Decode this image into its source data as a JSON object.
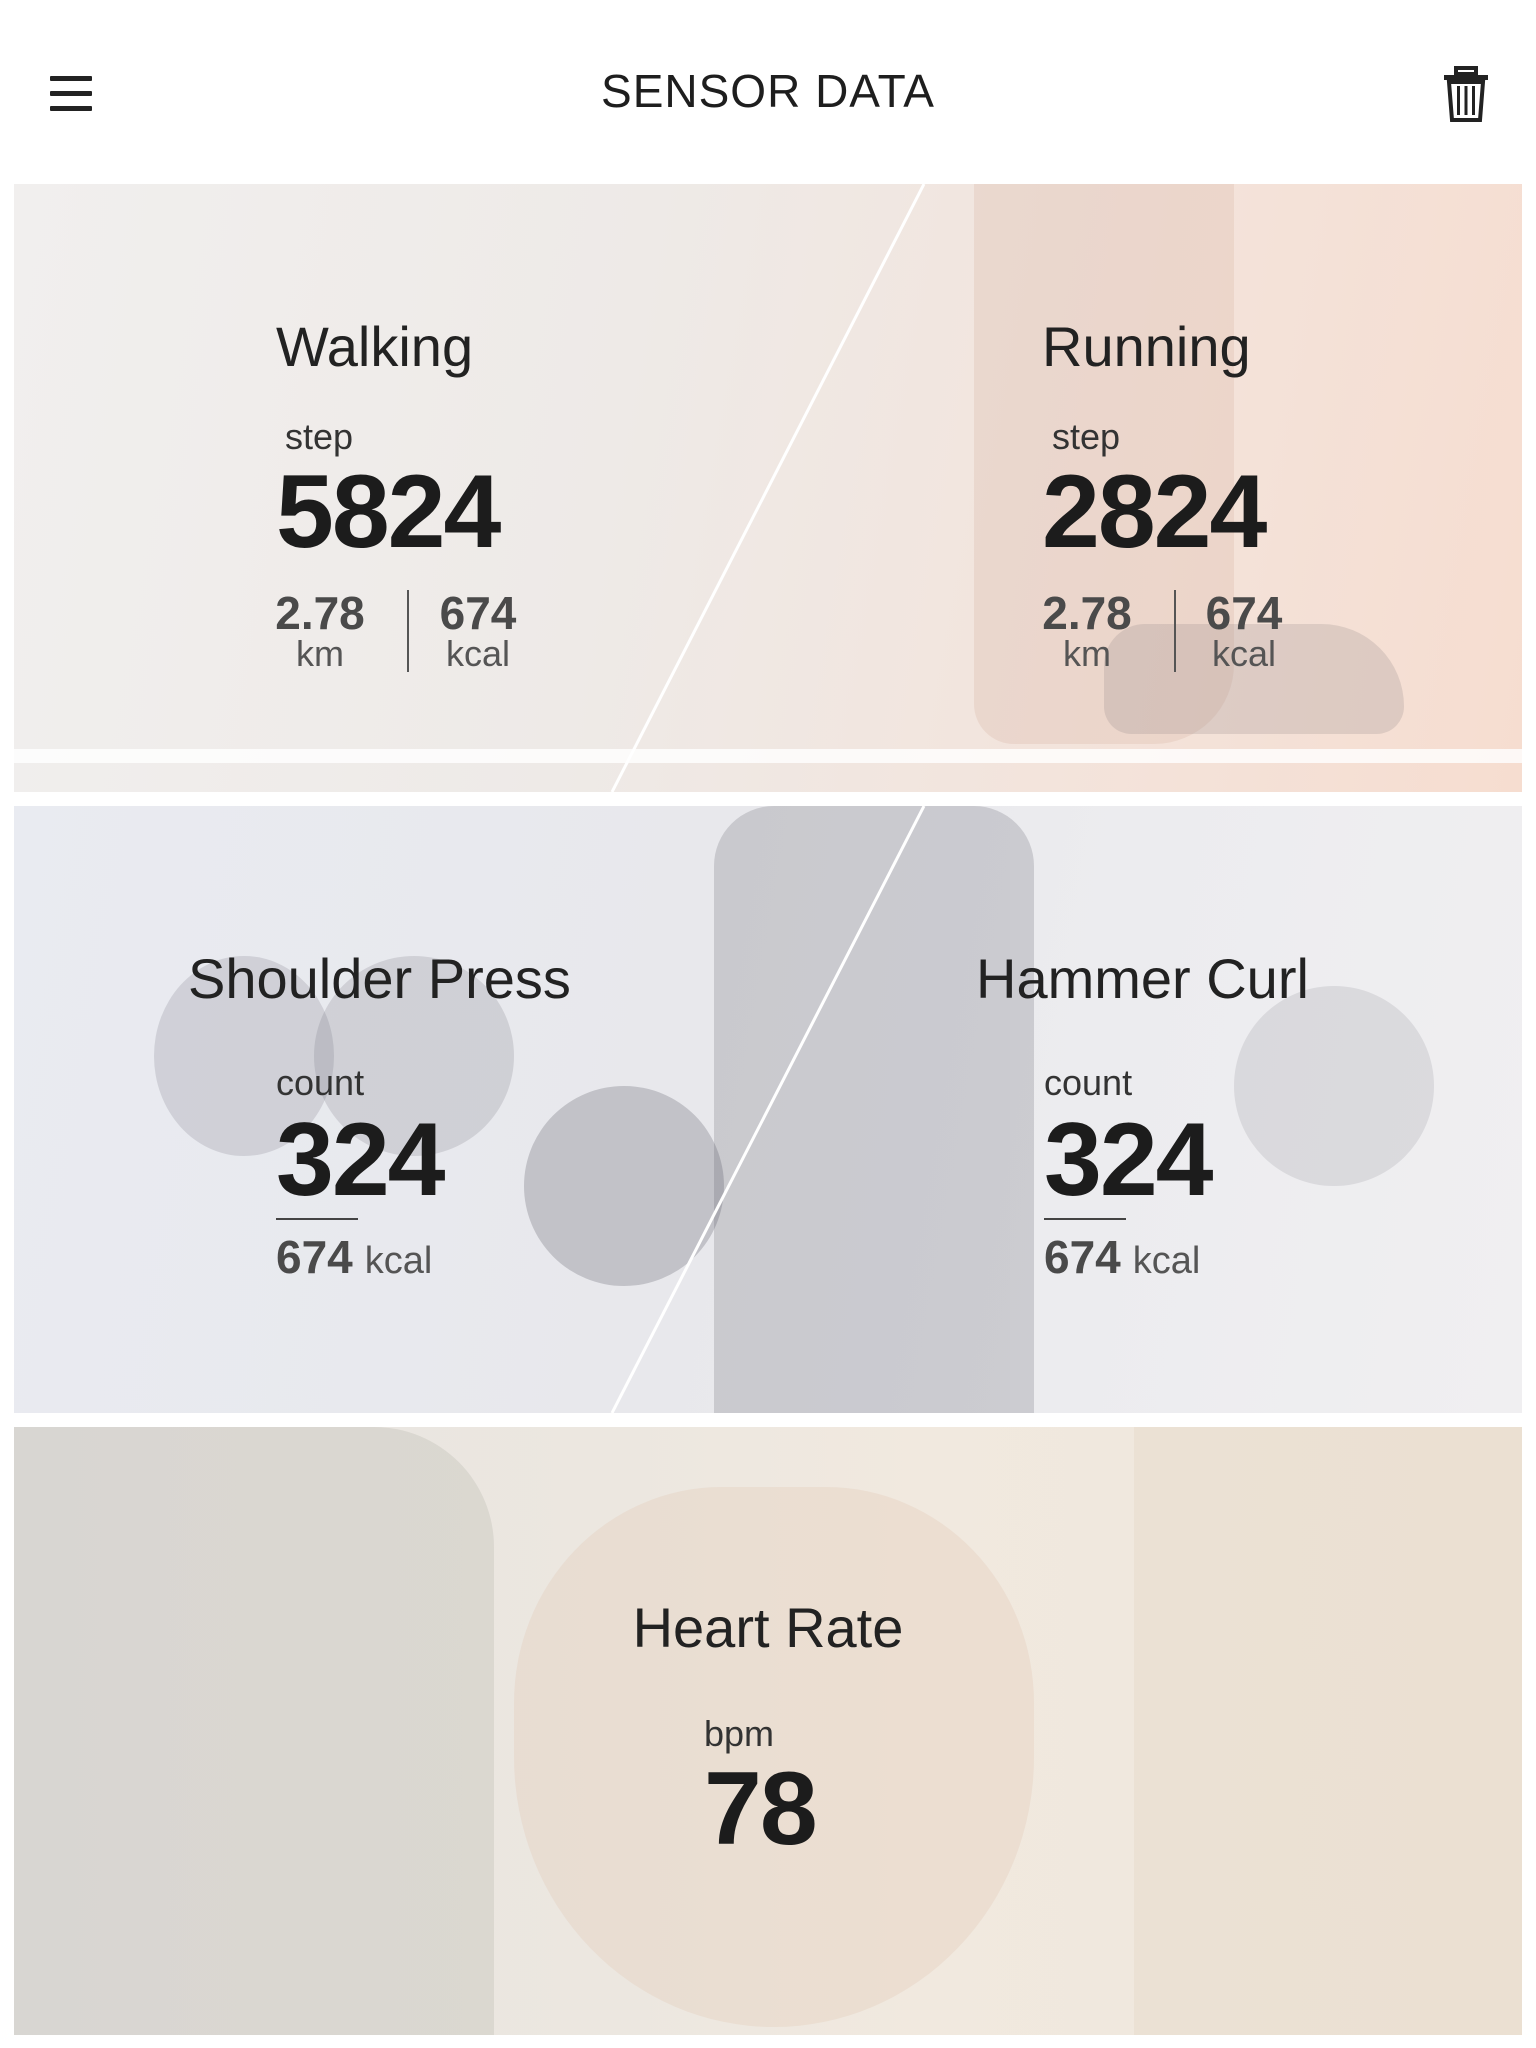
{
  "header": {
    "title": "SENSOR DATA",
    "menu_icon": "hamburger-menu-icon",
    "delete_icon": "trash-icon"
  },
  "walking": {
    "title": "Walking",
    "unit": "step",
    "value": "5824",
    "distance": "2.78",
    "distance_unit": "km",
    "calories": "674",
    "calories_unit": "kcal"
  },
  "running": {
    "title": "Running",
    "unit": "step",
    "value": "2824",
    "distance": "2.78",
    "distance_unit": "km",
    "calories": "674",
    "calories_unit": "kcal"
  },
  "shoulder_press": {
    "title": "Shoulder Press",
    "unit": "count",
    "value": "324",
    "calories": "674",
    "calories_unit": "kcal"
  },
  "hammer_curl": {
    "title": "Hammer Curl",
    "unit": "count",
    "value": "324",
    "calories": "674",
    "calories_unit": "kcal"
  },
  "heart_rate": {
    "title": "Heart Rate",
    "unit": "bpm",
    "value": "78"
  }
}
